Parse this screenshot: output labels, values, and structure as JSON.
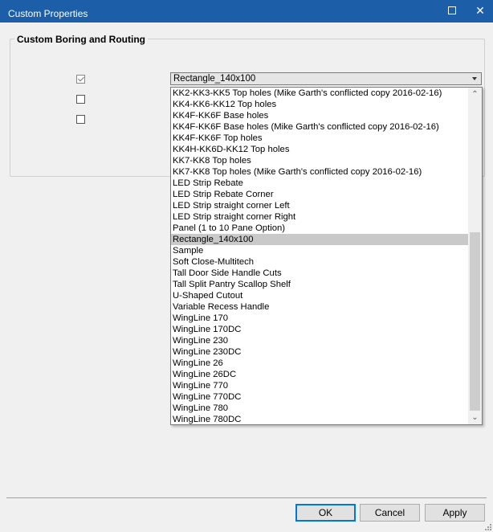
{
  "window": {
    "title": "Custom Properties"
  },
  "group": {
    "title": "Custom Boring and Routing"
  },
  "checkboxes": [
    {
      "checked": true
    },
    {
      "checked": false
    },
    {
      "checked": false
    }
  ],
  "combo": {
    "selected_value": "Rectangle_140x100"
  },
  "dropdown": {
    "items": [
      "KK2-KK3-KK5 Top holes (Mike Garth's conflicted copy 2016-02-16)",
      "KK4-KK6-KK12 Top holes",
      "KK4F-KK6F Base holes",
      "KK4F-KK6F Base holes (Mike Garth's conflicted copy 2016-02-16)",
      "KK4F-KK6F Top holes",
      "KK4H-KK6D-KK12 Top holes",
      "KK7-KK8 Top holes",
      "KK7-KK8 Top holes (Mike Garth's conflicted copy 2016-02-16)",
      "LED Strip Rebate",
      "LED Strip Rebate Corner",
      "LED Strip straight corner Left",
      "LED Strip straight corner Right",
      "Panel (1 to 10 Pane Option)",
      "Rectangle_140x100",
      "Sample",
      "Soft Close-Multitech",
      "Tall Door Side Handle Cuts",
      "Tall Split Pantry Scallop Shelf",
      "U-Shaped Cutout",
      "Variable Recess Handle",
      "WingLine 170",
      "WingLine 170DC",
      "WingLine 230",
      "WingLine 230DC",
      "WingLine 26",
      "WingLine 26DC",
      "WingLine 770",
      "WingLine 770DC",
      "WingLine 780",
      "WingLine 780DC"
    ],
    "selected_index": 13
  },
  "buttons": {
    "ok": "OK",
    "cancel": "Cancel",
    "apply": "Apply"
  },
  "icons": {
    "maximize": "maximize-icon",
    "close": "close-icon",
    "combo_arrow": "chevron-down-icon",
    "scroll_up": "chevron-up-icon",
    "scroll_down": "chevron-down-icon"
  },
  "colors": {
    "titlebar": "#1c5fa8",
    "selection": "#c9c9c9"
  }
}
